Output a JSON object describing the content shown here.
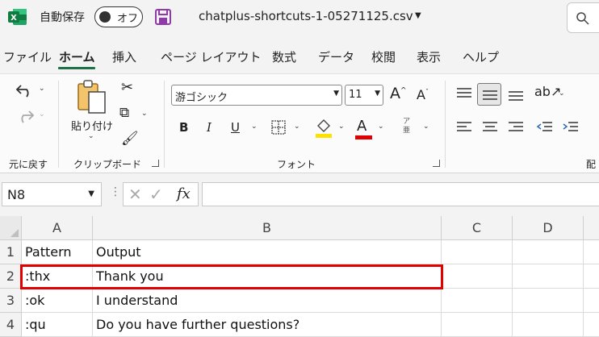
{
  "titlebar": {
    "autosave_label": "自動保存",
    "autosave_state": "オフ",
    "file_name": "chatplus-shortcuts-1-05271125.csv",
    "icons": [
      "excel-logo-icon",
      "save-icon",
      "chevron-down-icon",
      "search-icon"
    ]
  },
  "menu": {
    "tabs": [
      "ファイル",
      "ホーム",
      "挿入",
      "ページ レイアウト",
      "数式",
      "データ",
      "校閲",
      "表示",
      "ヘルプ"
    ],
    "active": "ホーム"
  },
  "ribbon": {
    "undo_group_label": "元に戻す",
    "clipboard": {
      "paste_label": "貼り付け",
      "group_label": "クリップボード"
    },
    "font": {
      "font_name": "游ゴシック",
      "font_size": "11",
      "bold": "B",
      "italic": "I",
      "underline": "U",
      "font_color_glyph": "A",
      "group_label": "フォント",
      "highlight_color": "#ffe100",
      "font_color": "#e00000"
    },
    "alignment_group_label_partial": "配"
  },
  "formula_bar": {
    "name_box": "N8",
    "fx": "fx",
    "formula": ""
  },
  "sheet": {
    "columns": [
      "A",
      "B",
      "C",
      "D"
    ],
    "rows": [
      {
        "num": "1",
        "a": "Pattern",
        "b": "Output"
      },
      {
        "num": "2",
        "a": ":thx",
        "b": "Thank you"
      },
      {
        "num": "3",
        "a": ":ok",
        "b": "I understand"
      },
      {
        "num": "4",
        "a": ":qu",
        "b": "Do you have further questions?"
      }
    ],
    "highlight_color": "#e00000"
  }
}
